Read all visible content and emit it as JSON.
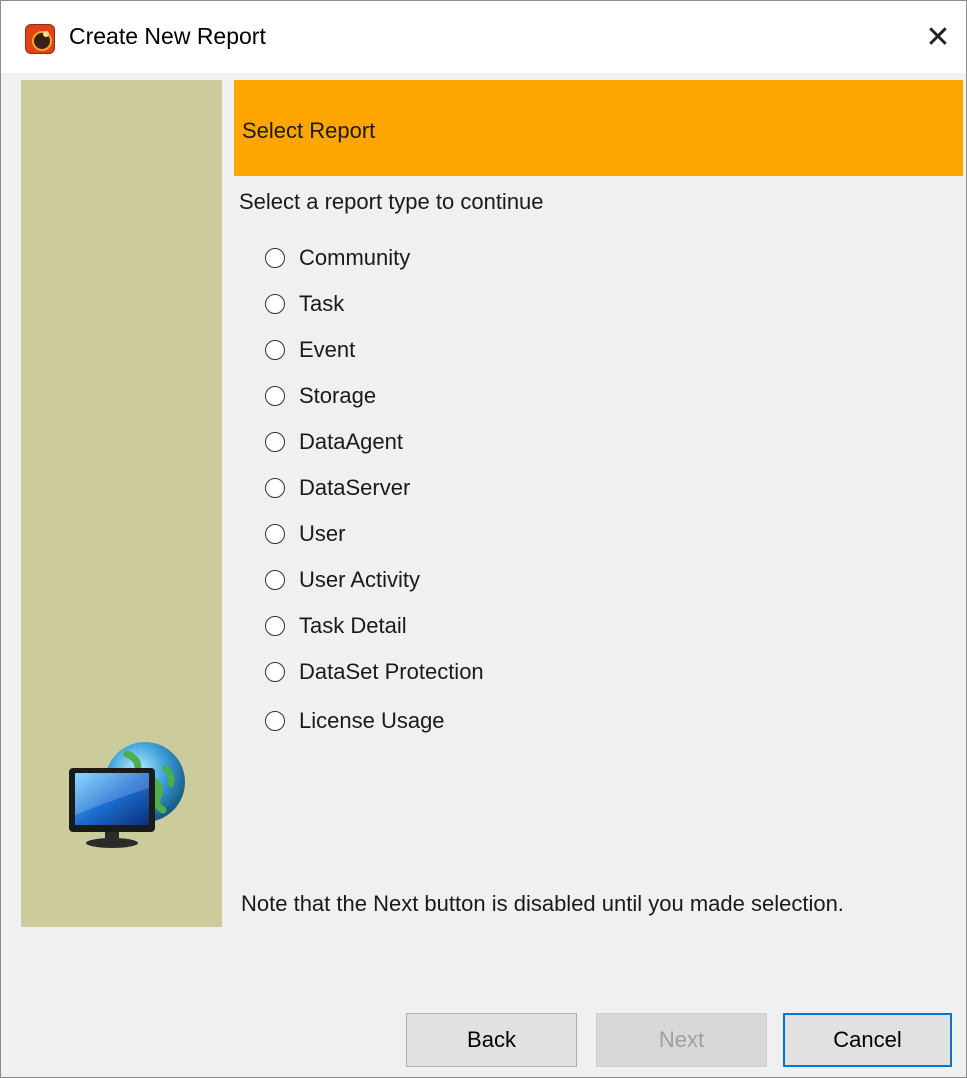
{
  "window": {
    "title": "Create New Report",
    "close_glyph": "✕",
    "icon": "app-logo-icon"
  },
  "sidebar": {
    "image": "monitor-globe-icon",
    "color": "#cccb9b"
  },
  "header": {
    "title": "Select Report",
    "color": "#ffa500"
  },
  "instruction": "Select a report type to continue",
  "options": [
    {
      "label": "Community",
      "selected": false
    },
    {
      "label": "Task",
      "selected": false
    },
    {
      "label": "Event",
      "selected": false
    },
    {
      "label": "Storage",
      "selected": false
    },
    {
      "label": "DataAgent",
      "selected": false
    },
    {
      "label": "DataServer",
      "selected": false
    },
    {
      "label": "User",
      "selected": false
    },
    {
      "label": "User Activity",
      "selected": false
    },
    {
      "label": "Task Detail",
      "selected": false
    },
    {
      "label": "DataSet Protection",
      "selected": false
    },
    {
      "label": "License Usage",
      "selected": false
    }
  ],
  "note": "Note that the Next button is disabled until you made selection.",
  "buttons": {
    "back": "Back",
    "next": "Next",
    "next_enabled": false,
    "cancel": "Cancel"
  }
}
